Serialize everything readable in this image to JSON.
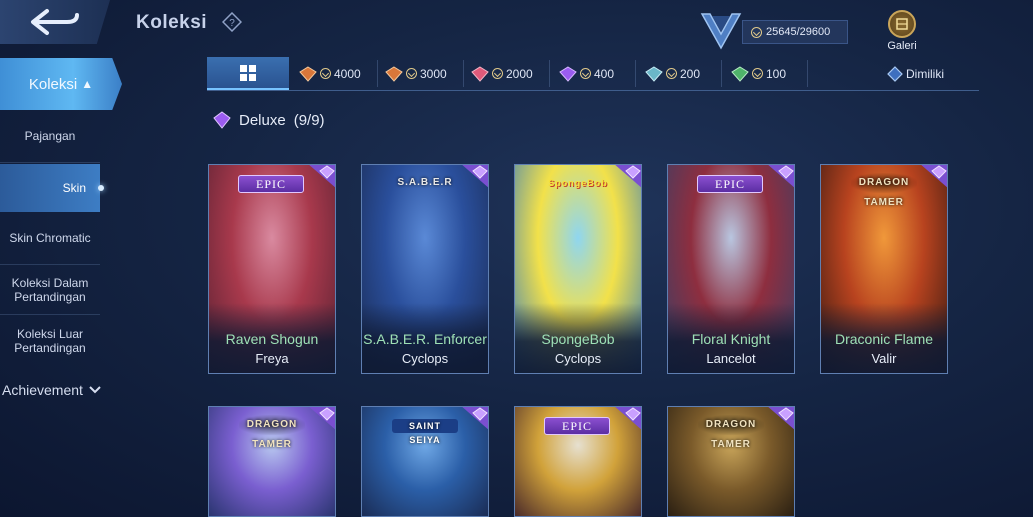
{
  "header": {
    "title": "Koleksi",
    "points": "25645/29600",
    "galeri_label": "Galeri"
  },
  "sidebar": {
    "main_label": "Koleksi",
    "items": [
      {
        "label": "Pajangan"
      },
      {
        "label": "Skin"
      },
      {
        "label": "Skin Chromatic"
      },
      {
        "label": "Koleksi Dalam Pertandingan"
      },
      {
        "label": "Koleksi Luar Pertandingan"
      }
    ],
    "achievement_label": "Achievement"
  },
  "tabs": [
    {
      "value": "4000",
      "color": "#d9773a"
    },
    {
      "value": "3000",
      "color": "#d9773a"
    },
    {
      "value": "2000",
      "color": "#e05a7a"
    },
    {
      "value": "400",
      "color": "#9b5cf0"
    },
    {
      "value": "200",
      "color": "#6bb7c9"
    },
    {
      "value": "100",
      "color": "#4fb36a"
    }
  ],
  "owned_label": "Dimiliki",
  "section": {
    "label": "Deluxe",
    "count": "(9/9)"
  },
  "cards_row1": [
    {
      "skin": "Raven Shogun",
      "hero": "Freya",
      "badge": "EPIC",
      "art": [
        "#d98aa0",
        "#a8394c",
        "#5a2233"
      ]
    },
    {
      "skin": "S.A.B.E.R. Enforcer",
      "hero": "Cyclops",
      "badge": "S.A.B.E.R",
      "art": [
        "#5a89d6",
        "#2a4f9c",
        "#1b2c55"
      ]
    },
    {
      "skin": "SpongeBob",
      "hero": "Cyclops",
      "badge": "SpongeBob",
      "art": [
        "#8fd6f0",
        "#f2e14a",
        "#3d7fb8"
      ]
    },
    {
      "skin": "Floral Knight",
      "hero": "Lancelot",
      "badge": "EPIC",
      "art": [
        "#b9c6e0",
        "#8e2e3f",
        "#3a3f66"
      ]
    },
    {
      "skin": "Draconic Flame",
      "hero": "Valir",
      "badge": "DRAGON TAMER",
      "art": [
        "#f0983a",
        "#b8431f",
        "#3a1a12"
      ]
    }
  ],
  "cards_row2": [
    {
      "badge": "DRAGON TAMER",
      "art": [
        "#b8c8f0",
        "#7a5fd0",
        "#2a3570"
      ]
    },
    {
      "badge": "SAINT SEIYA",
      "art": [
        "#6fa8e6",
        "#2b5fa8",
        "#1a2c55"
      ]
    },
    {
      "badge": "EPIC",
      "art": [
        "#e6e0d0",
        "#d1a23a",
        "#4a2a2a"
      ]
    },
    {
      "badge": "DRAGON TAMER",
      "art": [
        "#c9a55a",
        "#7a5a2a",
        "#2a1f12"
      ]
    }
  ]
}
